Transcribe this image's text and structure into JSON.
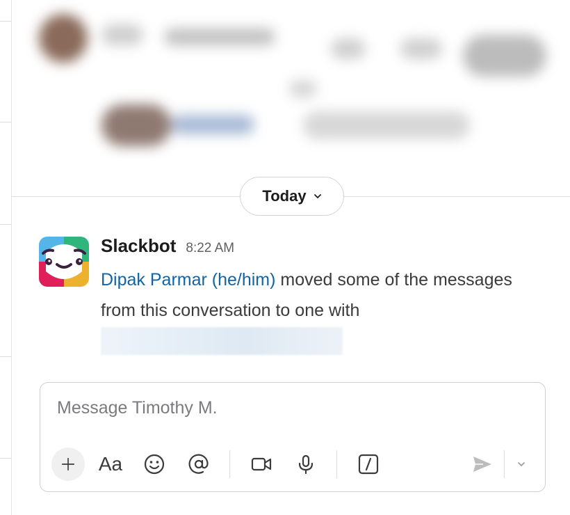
{
  "date_divider": {
    "label": "Today"
  },
  "message": {
    "sender": "Slackbot",
    "time": "8:22 AM",
    "mention": "Dipak Parmar (he/him)",
    "text": " moved some of the messages from this conversation to one with"
  },
  "composer": {
    "placeholder": "Message Timothy M.",
    "format_label": "Aa"
  },
  "colors": {
    "link": "#1264a3",
    "text": "#1d1c1d",
    "muted": "#616061",
    "slackbot_blue": "#56b5e8",
    "slackbot_green": "#2eb67d",
    "slackbot_red": "#e01e5a",
    "slackbot_yellow": "#ecb22e"
  }
}
